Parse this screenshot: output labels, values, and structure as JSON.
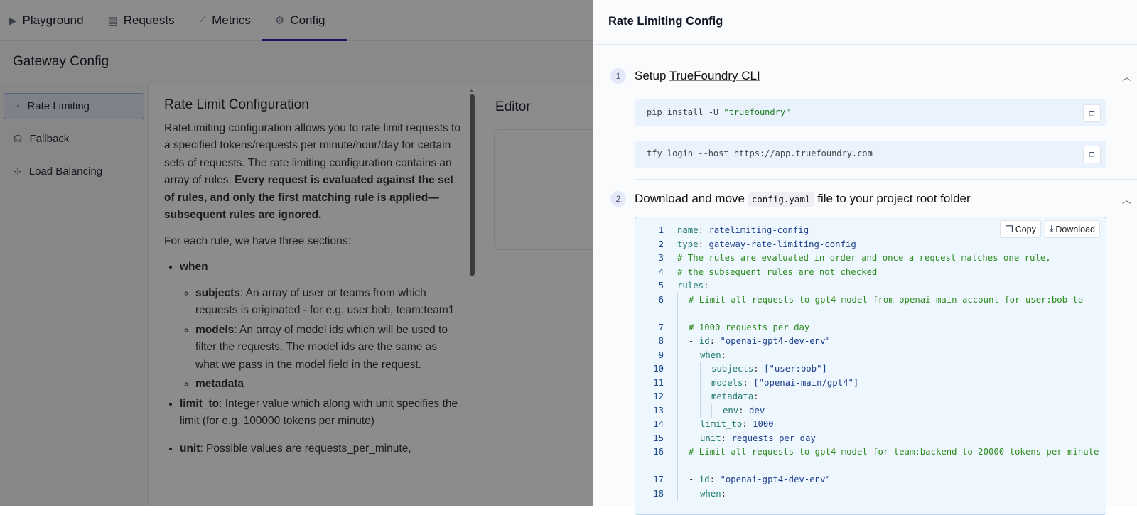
{
  "nav": {
    "tabs": [
      {
        "label": "Playground",
        "icon": "play-icon",
        "glyph": "▶"
      },
      {
        "label": "Requests",
        "icon": "document-icon",
        "glyph": "▤"
      },
      {
        "label": "Metrics",
        "icon": "chart-icon",
        "glyph": "⟋"
      },
      {
        "label": "Config",
        "icon": "gear-icon",
        "glyph": "⚙"
      }
    ],
    "active": "Config"
  },
  "page": {
    "title": "Gateway Config"
  },
  "sidebar": {
    "items": [
      {
        "label": "Rate Limiting",
        "glyph": "◔"
      },
      {
        "label": "Fallback",
        "glyph": "☊"
      },
      {
        "label": "Load Balancing",
        "glyph": "⊹"
      }
    ]
  },
  "content": {
    "title": "Rate Limit Configuration",
    "intro": "RateLimiting configuration allows you to rate limit requests to a specified tokens/requests per minute/hour/day for certain sets of requests. The rate limiting configuration contains an array of rules. ",
    "intro_bold": "Every request is evaluated against the set of rules, and only the first matching rule is applied—subsequent rules are ignored.",
    "sections_intro": "For each rule, we have three sections:",
    "when": "when",
    "subjects_b": "subjects",
    "subjects_t": ": An array of user or teams from which requests is originated - for e.g. user:bob, team:team1",
    "models_b": "models",
    "models_t": ": An array of model ids which will be used to filter the requests. The model ids are the same as what we pass in the model field in the request.",
    "metadata_b": "metadata",
    "limit_b": "limit_to",
    "limit_t": ": Integer value which along with unit specifies the limit (for e.g. 100000 tokens per minute)",
    "unit_b": "unit",
    "unit_t": ": Possible values are requests_per_minute,"
  },
  "editor": {
    "title": "Editor"
  },
  "drawer": {
    "title": "Rate Limiting Config",
    "step1": {
      "num": "1",
      "prefix": "Setup ",
      "link": "TrueFoundry CLI"
    },
    "cmd1": {
      "plain": "pip install -U ",
      "str": "\"truefoundry\""
    },
    "cmd2": "tfy login --host https://app.truefoundry.com",
    "step2": {
      "num": "2",
      "prefix": "Download and move ",
      "code": "config.yaml",
      "suffix": " file to your project root folder"
    },
    "copy_label": "Copy",
    "download_label": "Download",
    "code_lines": [
      {
        "n": "1",
        "d": 0,
        "t": [
          [
            "k",
            "name"
          ],
          [
            "p",
            ": "
          ],
          [
            "v",
            "ratelimiting-config"
          ]
        ]
      },
      {
        "n": "2",
        "d": 0,
        "t": [
          [
            "k",
            "type"
          ],
          [
            "p",
            ": "
          ],
          [
            "v",
            "gateway-rate-limiting-config"
          ]
        ]
      },
      {
        "n": "3",
        "d": 0,
        "t": [
          [
            "c",
            "# The rules are evaluated in order and once a request matches one rule,"
          ]
        ]
      },
      {
        "n": "4",
        "d": 0,
        "t": [
          [
            "c",
            "# the subsequent rules are not checked"
          ]
        ]
      },
      {
        "n": "5",
        "d": 0,
        "t": [
          [
            "k",
            "rules"
          ],
          [
            "p",
            ":"
          ]
        ]
      },
      {
        "n": "6",
        "d": 1,
        "t": [
          [
            "c",
            "# Limit all requests to gpt4 model from openai-main account for user:bob to"
          ]
        ]
      },
      {
        "n": "7",
        "d": 1,
        "t": [
          [
            "c",
            "# 1000 requests per day"
          ]
        ]
      },
      {
        "n": "8",
        "d": 1,
        "t": [
          [
            "p",
            "- "
          ],
          [
            "k",
            "id"
          ],
          [
            "p",
            ": "
          ],
          [
            "v",
            "\"openai-gpt4-dev-env\""
          ]
        ]
      },
      {
        "n": "9",
        "d": 2,
        "t": [
          [
            "k",
            "when"
          ],
          [
            "p",
            ":"
          ]
        ]
      },
      {
        "n": "10",
        "d": 3,
        "t": [
          [
            "k",
            "subjects"
          ],
          [
            "p",
            ": "
          ],
          [
            "v",
            "[\"user:bob\"]"
          ]
        ]
      },
      {
        "n": "11",
        "d": 3,
        "t": [
          [
            "k",
            "models"
          ],
          [
            "p",
            ": "
          ],
          [
            "v",
            "[\"openai-main/gpt4\"]"
          ]
        ]
      },
      {
        "n": "12",
        "d": 3,
        "t": [
          [
            "k",
            "metadata"
          ],
          [
            "p",
            ":"
          ]
        ]
      },
      {
        "n": "13",
        "d": 4,
        "t": [
          [
            "k",
            "env"
          ],
          [
            "p",
            ": "
          ],
          [
            "v",
            "dev"
          ]
        ]
      },
      {
        "n": "14",
        "d": 2,
        "t": [
          [
            "k",
            "limit_to"
          ],
          [
            "p",
            ": "
          ],
          [
            "v",
            "1000"
          ]
        ]
      },
      {
        "n": "15",
        "d": 2,
        "t": [
          [
            "k",
            "unit"
          ],
          [
            "p",
            ": "
          ],
          [
            "v",
            "requests_per_day"
          ]
        ]
      },
      {
        "n": "16",
        "d": 1,
        "t": [
          [
            "c",
            "# Limit all requests to gpt4 model for team:backend to 20000 tokens per minute"
          ]
        ]
      },
      {
        "n": "17",
        "d": 1,
        "t": [
          [
            "p",
            "- "
          ],
          [
            "k",
            "id"
          ],
          [
            "p",
            ": "
          ],
          [
            "v",
            "\"openai-gpt4-dev-env\""
          ]
        ]
      },
      {
        "n": "18",
        "d": 2,
        "t": [
          [
            "k",
            "when"
          ],
          [
            "p",
            ":"
          ]
        ]
      }
    ]
  }
}
